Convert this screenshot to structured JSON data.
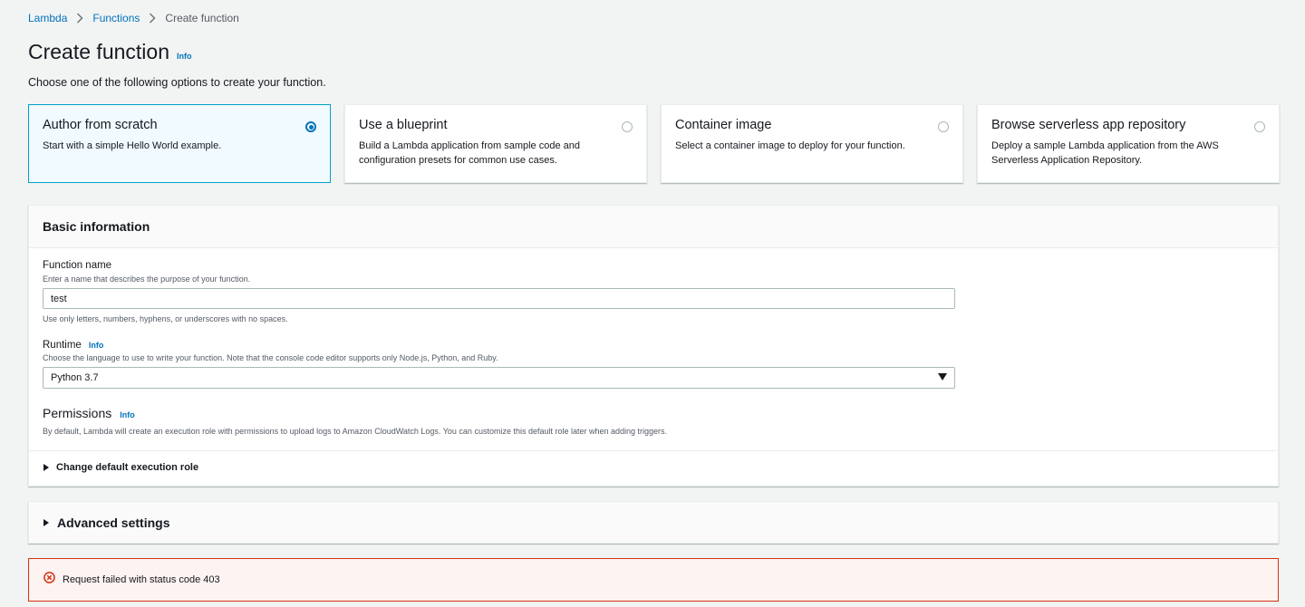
{
  "breadcrumb": {
    "items": [
      "Lambda",
      "Functions"
    ],
    "current": "Create function"
  },
  "page": {
    "title": "Create function",
    "info_label": "Info",
    "subtitle": "Choose one of the following options to create your function."
  },
  "options": [
    {
      "title": "Author from scratch",
      "description": "Start with a simple Hello World example.",
      "selected": true
    },
    {
      "title": "Use a blueprint",
      "description": "Build a Lambda application from sample code and configuration presets for common use cases.",
      "selected": false
    },
    {
      "title": "Container image",
      "description": "Select a container image to deploy for your function.",
      "selected": false
    },
    {
      "title": "Browse serverless app repository",
      "description": "Deploy a sample Lambda application from the AWS Serverless Application Repository.",
      "selected": false
    }
  ],
  "basic_info": {
    "heading": "Basic information",
    "function_name": {
      "label": "Function name",
      "description": "Enter a name that describes the purpose of your function.",
      "value": "test",
      "constraint": "Use only letters, numbers, hyphens, or underscores with no spaces."
    },
    "runtime": {
      "label": "Runtime",
      "info_label": "Info",
      "description": "Choose the language to use to write your function. Note that the console code editor supports only Node.js, Python, and Ruby.",
      "value": "Python 3.7"
    },
    "permissions": {
      "label": "Permissions",
      "info_label": "Info",
      "description": "By default, Lambda will create an execution role with permissions to upload logs to Amazon CloudWatch Logs. You can customize this default role later when adding triggers.",
      "expander": "Change default execution role"
    }
  },
  "advanced": {
    "label": "Advanced settings"
  },
  "error": {
    "message": "Request failed with status code 403",
    "color": "#d13212"
  },
  "colors": {
    "link": "#0073bb",
    "selected_border": "#00a1c9",
    "selected_bg": "#f1faff",
    "page_bg": "#f2f3f3"
  }
}
